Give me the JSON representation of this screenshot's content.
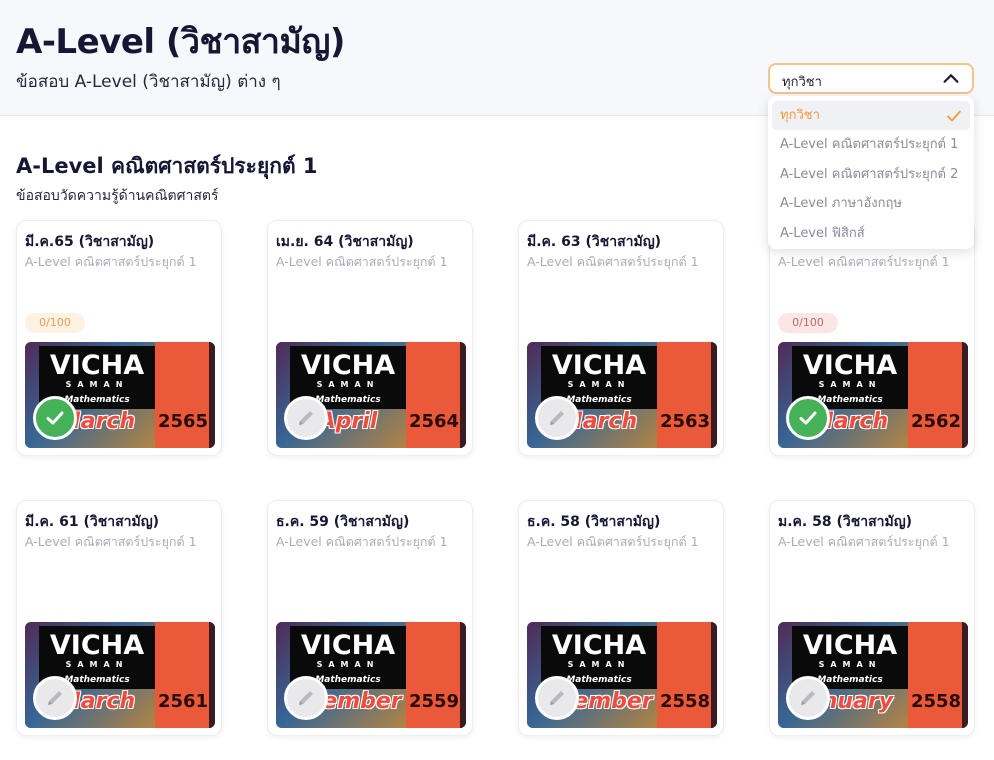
{
  "header": {
    "title": "A-Level (วิชาสามัญ)",
    "subtitle": "ข้อสอบ A-Level (วิชาสามัญ) ต่าง ๆ"
  },
  "filter": {
    "selected": "ทุกวิชา",
    "options": [
      "ทุกวิชา",
      "A-Level คณิตศาสตร์ประยุกต์ 1",
      "A-Level คณิตศาสตร์ประยุกต์ 2",
      "A-Level ภาษาอังกฤษ",
      "A-Level ฟิสิกส์"
    ],
    "accent_color": "#f39a3a"
  },
  "section": {
    "title": "A-Level คณิตศาสตร์ประยุกต์ 1",
    "subtitle": "ข้อสอบวัดความรู้ด้านคณิตศาสตร์"
  },
  "thumbnail_brand": {
    "line1": "VICHA",
    "line2": "SAMAN",
    "line3": "Mathematics"
  },
  "exams": [
    {
      "title": "มี.ค.65 (วิชาสามัญ)",
      "subject": "A-Level คณิตศาสตร์ประยุกต์ 1",
      "score": "0/100",
      "score_style": "orange",
      "month": "March",
      "year": "2565",
      "status_icon": "check-icon"
    },
    {
      "title": "เม.ย. 64 (วิชาสามัญ)",
      "subject": "A-Level คณิตศาสตร์ประยุกต์ 1",
      "score": "",
      "score_style": "",
      "month": "April",
      "year": "2564",
      "status_icon": "pencil-icon"
    },
    {
      "title": "มี.ค. 63 (วิชาสามัญ)",
      "subject": "A-Level คณิตศาสตร์ประยุกต์ 1",
      "score": "",
      "score_style": "",
      "month": "March",
      "year": "2563",
      "status_icon": "pencil-icon"
    },
    {
      "title": "",
      "subject": "A-Level คณิตศาสตร์ประยุกต์ 1",
      "score": "0/100",
      "score_style": "red",
      "month": "March",
      "year": "2562",
      "status_icon": "check-icon"
    },
    {
      "title": "มี.ค. 61 (วิชาสามัญ)",
      "subject": "A-Level คณิตศาสตร์ประยุกต์ 1",
      "score": "",
      "score_style": "",
      "month": "March",
      "year": "2561",
      "status_icon": "pencil-icon"
    },
    {
      "title": "ธ.ค. 59 (วิชาสามัญ)",
      "subject": "A-Level คณิตศาสตร์ประยุกต์ 1",
      "score": "",
      "score_style": "",
      "month": "ecember",
      "year": "2559",
      "status_icon": "pencil-icon"
    },
    {
      "title": "ธ.ค. 58 (วิชาสามัญ)",
      "subject": "A-Level คณิตศาสตร์ประยุกต์ 1",
      "score": "",
      "score_style": "",
      "month": "ecember",
      "year": "2558",
      "status_icon": "pencil-icon"
    },
    {
      "title": "ม.ค. 58 (วิชาสามัญ)",
      "subject": "A-Level คณิตศาสตร์ประยุกต์ 1",
      "score": "",
      "score_style": "",
      "month": "anuary",
      "year": "2558",
      "status_icon": "pencil-icon"
    }
  ]
}
